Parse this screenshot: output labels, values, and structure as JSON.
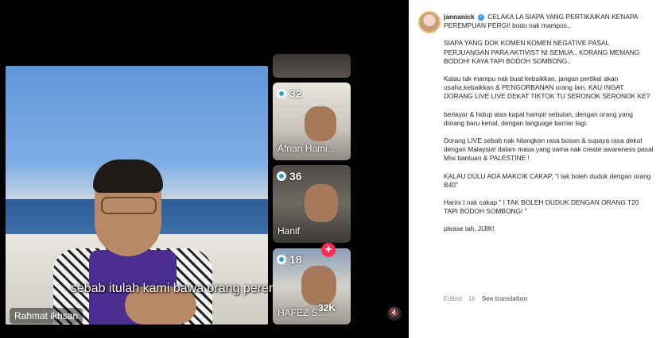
{
  "video": {
    "subtitle": "sebab itulah kami bawa orang perempuan kami",
    "host_name": "Rahmat ikhsan",
    "tiles": [
      {
        "name": "",
        "viewers": ""
      },
      {
        "name": "Afnan Hami...",
        "viewers": "32"
      },
      {
        "name": "Hanif",
        "viewers": "36"
      },
      {
        "name": "HAFEZ S...",
        "viewers": "18"
      }
    ],
    "total_count": "32K",
    "add_symbol": "+",
    "mute_symbol": "🔇"
  },
  "post": {
    "username": "jannanick",
    "verified_symbol": "✓",
    "lines": [
      "CELAKA LA SIAPA YANG PERTIKAIKAN KENAPA PEREMPUAN PERGI! bodo nak mampos..",
      "SIAPA YANG DOK KOMEN KOMEN NEGATIVE PASAL PERJUANGAN PARA AKTIVIST NI SEMUA.. KORANG MEMANG BODOH! KAYA TAPI BODOH SOMBONG..",
      "Kalau tak mampu nak buat kebaikkan, jangan pertikai akan usaha,kebaikkan & PENGORBANAN orang lain. KAU INGAT DORANG LIVE LIVE DEKAT TIKTOK TU SERONOK SERONOK KE?",
      "berlayar & hidup atas kapal hampir sebulan, dengan orang yang dorang baru kenal, dengan language barrier lagi.",
      "Dorang LIVE sebab nak hilangkan rasa bosan & supaya rasa dekat dengan Malaysia! dalam masa yang sama nak create awareness pasal Misi bantuan & PALESTINE !",
      "KALAU DULU ADA MAKCIK CAKAP, \"i tak boleh duduk dengan orang B40\"",
      "Harini I nak cakap \" I TAK BOLEH DUDUK DENGAN ORANG T20 TAPI BODOH SOMBONG! \"",
      "please lah, JIJIK!"
    ],
    "edited": "Edited",
    "time": "1h",
    "see_translation": "See translation"
  }
}
